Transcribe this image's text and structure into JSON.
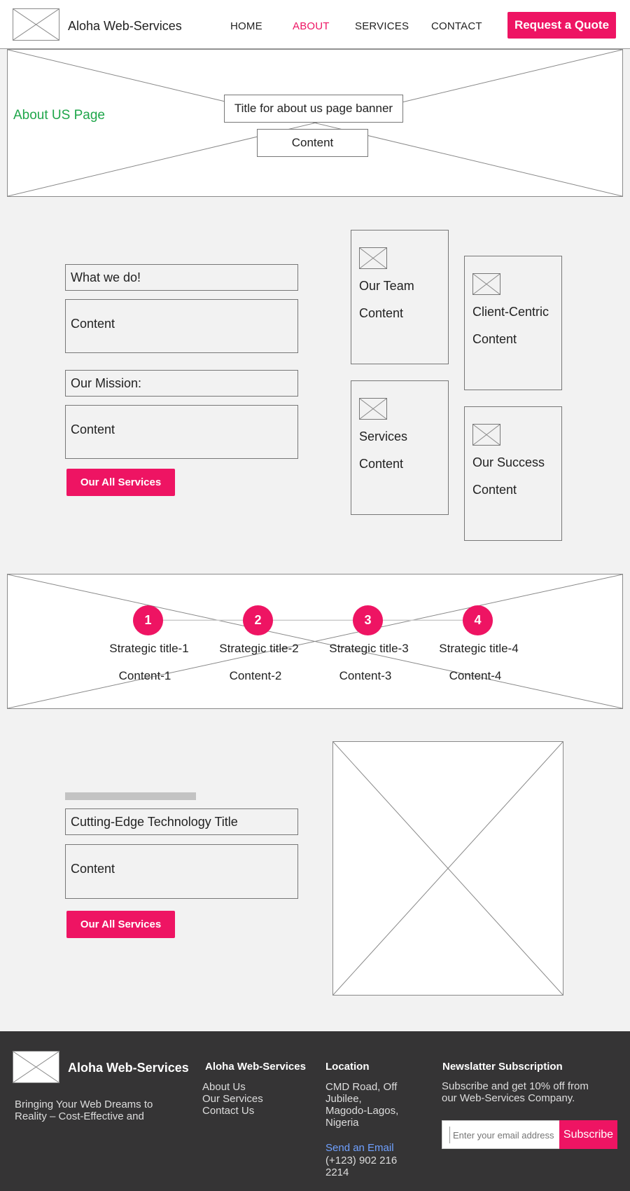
{
  "header": {
    "brand": "Aloha Web-Services",
    "nav": [
      {
        "label": "HOME",
        "active": false
      },
      {
        "label": "ABOUT",
        "active": true
      },
      {
        "label": "SERVICES",
        "active": false
      },
      {
        "label": "CONTACT",
        "active": false
      }
    ],
    "cta_label": "Request a Quote"
  },
  "banner": {
    "page_label": "About US Page",
    "title": "Title for about us page banner",
    "content": "Content"
  },
  "about": {
    "what_title": "What we do!",
    "what_content": "Content",
    "mission_title": "Our Mission:",
    "mission_content": "Content",
    "button_label": "Our All Services"
  },
  "features": [
    {
      "title": "Our Team",
      "content": "Content"
    },
    {
      "title": "Client-Centric",
      "content": "Content"
    },
    {
      "title": "Services",
      "content": "Content"
    },
    {
      "title": "Our Success",
      "content": "Content"
    }
  ],
  "strategy": [
    {
      "number": "1",
      "title": "Strategic title-1",
      "content": "Content-1"
    },
    {
      "number": "2",
      "title": "Strategic title-2",
      "content": "Content-2"
    },
    {
      "number": "3",
      "title": "Strategic title-3",
      "content": "Content-3"
    },
    {
      "number": "4",
      "title": "Strategic title-4",
      "content": "Content-4"
    }
  ],
  "tech": {
    "title": "Cutting-Edge Technology Title",
    "content": "Content",
    "button_label": "Our All Services"
  },
  "footer": {
    "brand": "Aloha Web-Services",
    "tagline": "Bringing Your Web Dreams to Reality – Cost-Effective and",
    "links_title": "Aloha Web-Services",
    "links": [
      "About Us",
      "Our Services",
      "Contact Us"
    ],
    "location_title": "Location",
    "address": "CMD Road, Off Jubilee, Magodo-Lagos, Nigeria",
    "email_link": "Send an Email",
    "phone": "(+123) 902 216 2214",
    "newsletter_title": "Newslatter Subscription",
    "newsletter_text": "Subscribe and get 10% off from our Web-Services Company.",
    "email_placeholder": "Enter your email address",
    "subscribe_label": "Subscribe"
  },
  "colors": {
    "accent": "#ee1463",
    "page_label": "#1fa64a",
    "footer_bg": "#353435",
    "email_link": "#6fa0ff"
  }
}
